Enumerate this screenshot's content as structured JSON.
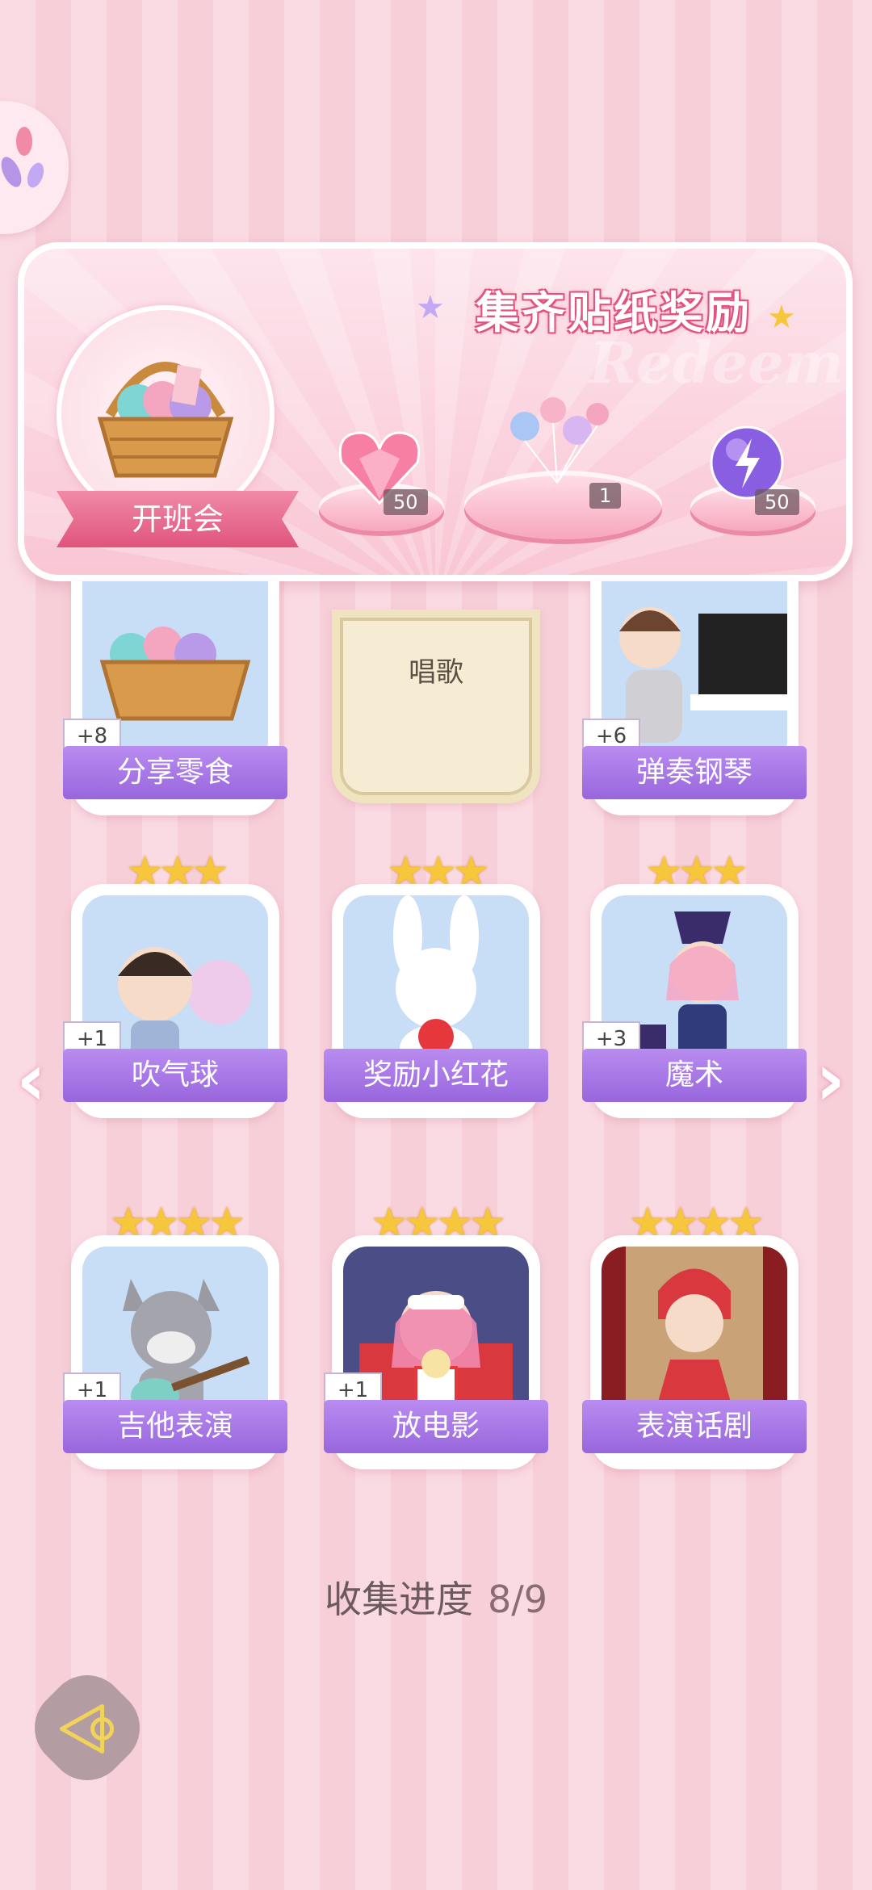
{
  "reward_panel": {
    "title": "集齐贴纸奖励",
    "watermark": "Redeem",
    "event_label": "开班会",
    "rewards": [
      {
        "icon": "heart-gem-icon",
        "count": "50"
      },
      {
        "icon": "balloon-bunch-icon",
        "count": "1"
      },
      {
        "icon": "lightning-orb-icon",
        "count": "50"
      }
    ]
  },
  "stickers": [
    {
      "label": "分享零食",
      "bonus": "+8",
      "stars": "",
      "icon": "snack-basket-icon"
    },
    {
      "label": "唱歌",
      "bonus": "",
      "stars": "",
      "icon": "",
      "locked": true
    },
    {
      "label": "弹奏钢琴",
      "bonus": "+6",
      "stars": "",
      "icon": "piano-player-icon"
    },
    {
      "label": "吹气球",
      "bonus": "+1",
      "stars": "★★★",
      "icon": "bubble-boy-icon"
    },
    {
      "label": "奖励小红花",
      "bonus": "",
      "stars": "★★★",
      "icon": "bunny-flower-icon"
    },
    {
      "label": "魔术",
      "bonus": "+3",
      "stars": "★★★",
      "icon": "magician-girl-icon"
    },
    {
      "label": "吉他表演",
      "bonus": "+1",
      "stars": "★★★★",
      "icon": "wolf-guitar-icon"
    },
    {
      "label": "放电影",
      "bonus": "+1",
      "stars": "★★★★",
      "icon": "popcorn-girl-icon"
    },
    {
      "label": "表演话剧",
      "bonus": "",
      "stars": "★★★★",
      "icon": "stage-cat-girl-icon"
    }
  ],
  "progress": {
    "label": "收集进度",
    "value": "8/9"
  },
  "colors": {
    "accent_pink": "#e0547d",
    "label_purple": "#9866dd",
    "star_gold": "#f6c63b"
  }
}
